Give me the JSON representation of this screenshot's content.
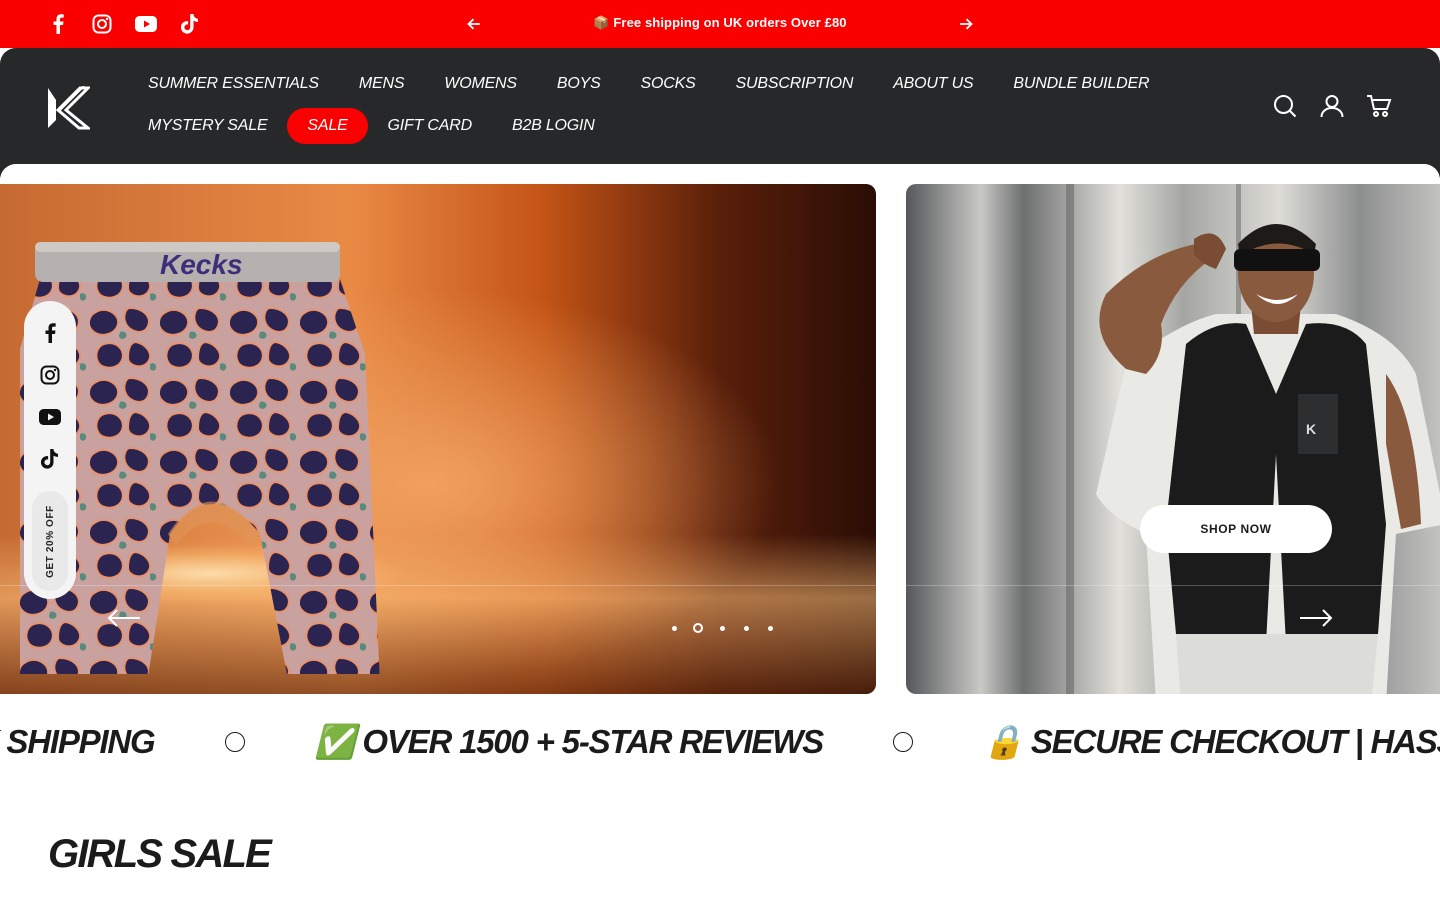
{
  "announcement": {
    "social": [
      "facebook-icon",
      "instagram-icon",
      "youtube-icon",
      "tiktok-icon"
    ],
    "message": "📦 Free shipping on UK orders Over £80",
    "prev_icon": "arrow-left-icon",
    "next_icon": "arrow-right-icon",
    "background": "#fb0000"
  },
  "header": {
    "logo_icon": "kecks-logo-icon",
    "nav": [
      {
        "label": "SUMMER ESSENTIALS"
      },
      {
        "label": "MENS"
      },
      {
        "label": "WOMENS"
      },
      {
        "label": "BOYS"
      },
      {
        "label": "SOCKS"
      },
      {
        "label": "SUBSCRIPTION"
      },
      {
        "label": "ABOUT US"
      },
      {
        "label": "BUNDLE BUILDER"
      },
      {
        "label": "MYSTERY SALE"
      },
      {
        "label": "SALE"
      },
      {
        "label": "GIFT CARD"
      },
      {
        "label": "B2B LOGIN"
      }
    ],
    "active_nav": "SALE",
    "icons": [
      "search-icon",
      "account-icon",
      "cart-icon"
    ],
    "background": "#27282a"
  },
  "hero": {
    "product_brand": "Kecks",
    "shop_now_label": "SHOP NOW",
    "dots_count": 5,
    "active_dot": 2,
    "prev_icon": "arrow-left-long-icon",
    "next_icon": "arrow-right-long-icon"
  },
  "floating_social": {
    "icons": [
      "facebook-icon",
      "instagram-icon",
      "youtube-icon",
      "tiktok-icon"
    ],
    "promo_label": "GET 20% OFF"
  },
  "marquee": {
    "items": [
      "FREE UK SHIPPING",
      "✅ OVER 1500 + 5-STAR REVIEWS",
      "🔒 SECURE CHECKOUT | HASSLE-FREE RETURNS"
    ]
  },
  "section": {
    "title": "GIRLS SALE"
  }
}
